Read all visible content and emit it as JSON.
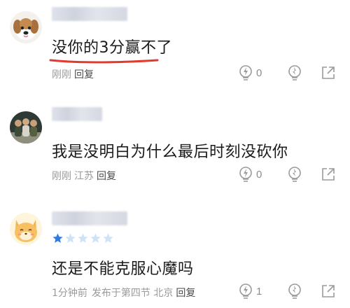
{
  "comments": [
    {
      "text": "没你的3分赢不了",
      "time": "刚刚",
      "location": "",
      "published": "",
      "reply_label": "回复",
      "like_count": "0",
      "avatar_icon": "puppy-avatar",
      "underlined": true
    },
    {
      "text": "我是没明白为什么最后时刻没砍你",
      "time": "刚刚",
      "location": "江苏",
      "published": "",
      "reply_label": "回复",
      "like_count": "0",
      "avatar_icon": "group-photo-avatar",
      "underlined": false
    },
    {
      "text": "还是不能克服心魔吗",
      "time": "1分钟前",
      "location": "",
      "published": "发布于第四节 北京",
      "reply_label": "回复",
      "like_count": "1",
      "avatar_icon": "cat-avatar",
      "rating_filled": 1,
      "rating_total": 5
    }
  ],
  "colors": {
    "underline": "#e23b2e",
    "star_filled": "#2d7be5",
    "star_empty": "#cfe3f7",
    "icon": "#9a9a9a"
  }
}
